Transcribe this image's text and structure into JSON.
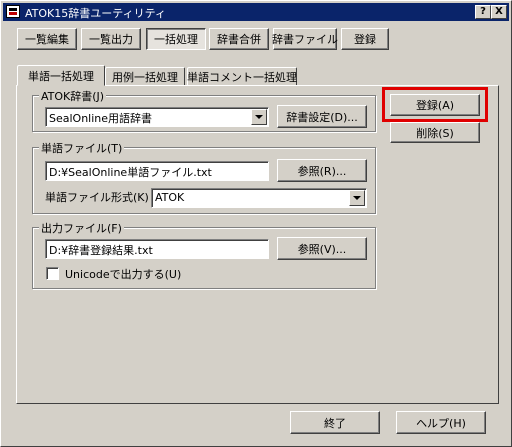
{
  "window": {
    "title": "ATOK15辞書ユーティリティ",
    "help_glyph": "?",
    "close_glyph": "X"
  },
  "toolbar": [
    {
      "label": "一覧編集"
    },
    {
      "label": "一覧出力"
    },
    {
      "label": "一括処理",
      "active": true
    },
    {
      "label": "辞書合併"
    },
    {
      "label": "辞書ファイル"
    },
    {
      "label": "登録"
    }
  ],
  "tabs": [
    {
      "label": "単語一括処理",
      "active": true
    },
    {
      "label": "用例一括処理"
    },
    {
      "label": "単語コメント一括処理"
    }
  ],
  "atok_dict": {
    "legend": "ATOK辞書(J)",
    "selected": "SealOnline用語辞書",
    "settings_button": "辞書設定(D)..."
  },
  "word_file": {
    "legend": "単語ファイル(T)",
    "path": "D:¥SealOnline単語ファイル.txt",
    "browse_button": "参照(R)...",
    "format_label": "単語ファイル形式(K)",
    "format_value": "ATOK"
  },
  "output_file": {
    "legend": "出力ファイル(F)",
    "path": "D:¥辞書登録結果.txt",
    "browse_button": "参照(V)...",
    "unicode_label": "Unicodeで出力する(U)",
    "unicode_checked": false
  },
  "side_buttons": {
    "register": "登録(A)",
    "delete": "削除(S)"
  },
  "footer": {
    "exit": "終了",
    "help": "ヘルプ(H)"
  },
  "colors": {
    "titlebar": "#0a246a",
    "face": "#d4d0c8",
    "highlight": "#e00000"
  }
}
